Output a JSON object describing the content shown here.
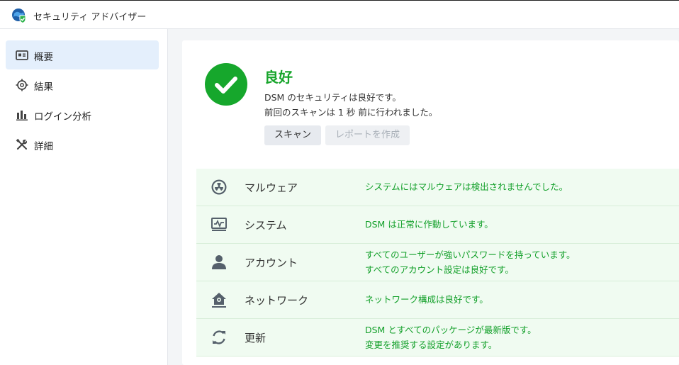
{
  "app": {
    "title": "セキュリティ アドバイザー",
    "icon": "security-advisor-logo-icon"
  },
  "sidebar": {
    "items": [
      {
        "label": "概要",
        "icon": "overview-icon",
        "active": true
      },
      {
        "label": "結果",
        "icon": "target-icon",
        "active": false
      },
      {
        "label": "ログイン分析",
        "icon": "bar-chart-icon",
        "active": false
      },
      {
        "label": "詳細",
        "icon": "tools-icon",
        "active": false
      }
    ]
  },
  "status": {
    "title": "良好",
    "line1": "DSM のセキュリティは良好です。",
    "line2": "前回のスキャンは 1 秒 前に行われました。",
    "icon": "checkmark-icon",
    "color": "#16a72c"
  },
  "buttons": {
    "scan": "スキャン",
    "report": "レポートを作成"
  },
  "results": [
    {
      "label": "マルウェア",
      "icon": "radiation-icon",
      "messages": [
        "システムにはマルウェアは検出されませんでした。"
      ]
    },
    {
      "label": "システム",
      "icon": "system-monitor-icon",
      "messages": [
        "DSM は正常に作動しています。"
      ]
    },
    {
      "label": "アカウント",
      "icon": "user-icon",
      "messages": [
        "すべてのユーザーが強いパスワードを持っています。",
        "すべてのアカウント設定は良好です。"
      ]
    },
    {
      "label": "ネットワーク",
      "icon": "network-home-icon",
      "messages": [
        "ネットワーク構成は良好です。"
      ]
    },
    {
      "label": "更新",
      "icon": "refresh-icon",
      "messages": [
        "DSM とすべてのパッケージが最新版です。",
        "変更を推奨する設定があります。"
      ]
    }
  ]
}
